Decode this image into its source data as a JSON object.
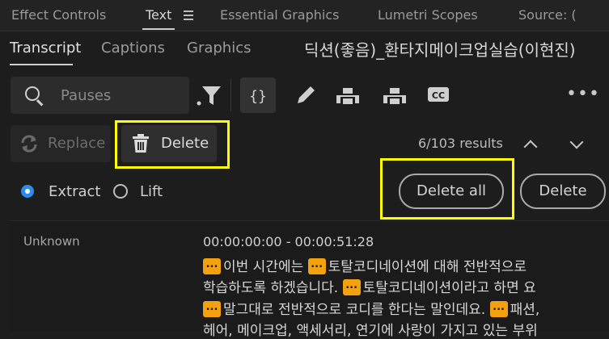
{
  "panel_tabs": [
    "Effect Controls",
    "Text",
    "Essential Graphics",
    "Lumetri Scopes",
    "Source: ("
  ],
  "sub_tabs": [
    "Transcript",
    "Captions",
    "Graphics"
  ],
  "sequence_title": "딕션(좋음)_환타지메이크업실습(이현진)",
  "search": {
    "placeholder": "Pauses"
  },
  "toolbar": {
    "more": "•••",
    "cc_label": "CC"
  },
  "actions": {
    "replace_label": "Replace",
    "delete_label": "Delete"
  },
  "results": "6/103 results",
  "mode": {
    "extract_label": "Extract",
    "lift_label": "Lift",
    "selected": "Extract"
  },
  "buttons": {
    "delete_all": "Delete all",
    "delete": "Delete"
  },
  "transcript": {
    "speaker": "Unknown",
    "timecode": "00:00:00:00 - 00:00:51:28",
    "pause_glyph": "...",
    "line1a": "이번 시간에는",
    "line1b": "토탈코디네이션에 대해 전반적으로",
    "line2a": "학습하도록 하겠습니다.",
    "line2b": "토탈코디네이션이라고 하면 요",
    "line3a": "말그대로 전반적으로 코디를 한다는 말인데요.",
    "line3b": "패션,",
    "line4": "헤어, 메이크업, 액세서리, 연기에 사랑이 가지고 있는 부위"
  },
  "colors": {
    "highlight": "#ffff00",
    "pause_marker": "#f3a10d",
    "radio_selected": "#2d8ceb"
  }
}
